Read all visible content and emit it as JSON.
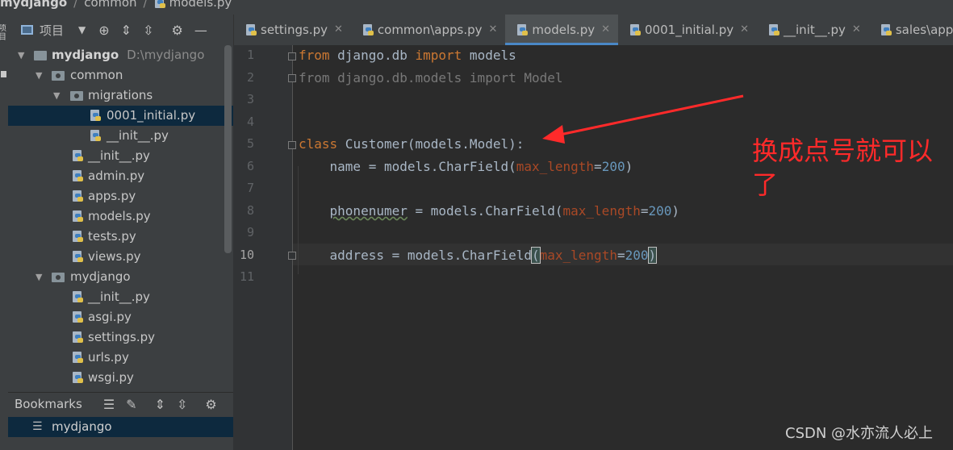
{
  "breadcrumb": {
    "project": "mydjango",
    "folder": "common",
    "file": "models.py"
  },
  "left_strip": {
    "vertical_label": "项目"
  },
  "project_panel": {
    "title": "项目",
    "toolbar_icons": [
      "chevron-down-icon",
      "crosshair-icon",
      "expand-icon",
      "collapse-icon",
      "gear-icon",
      "minimize-icon"
    ],
    "root": {
      "name": "mydjango",
      "path": "D:\\mydjango"
    },
    "items": [
      {
        "label": "common"
      },
      {
        "label": "migrations"
      },
      {
        "label": "0001_initial.py"
      },
      {
        "label": "__init__.py"
      },
      {
        "label": "__init__.py"
      },
      {
        "label": "admin.py"
      },
      {
        "label": "apps.py"
      },
      {
        "label": "models.py"
      },
      {
        "label": "tests.py"
      },
      {
        "label": "views.py"
      },
      {
        "label": "mydjango"
      },
      {
        "label": "__init__.py"
      },
      {
        "label": "asgi.py"
      },
      {
        "label": "settings.py"
      },
      {
        "label": "urls.py"
      },
      {
        "label": "wsgi.py"
      }
    ]
  },
  "bookmarks": {
    "title": "Bookmarks",
    "item": "mydjango"
  },
  "tabs": [
    {
      "label": "settings.py"
    },
    {
      "label": "common\\apps.py"
    },
    {
      "label": "models.py",
      "active": true
    },
    {
      "label": "0001_initial.py"
    },
    {
      "label": "__init__.py"
    },
    {
      "label": "sales\\apps.py"
    }
  ],
  "editor": {
    "line_numbers": [
      "1",
      "2",
      "3",
      "4",
      "5",
      "6",
      "7",
      "8",
      "9",
      "10",
      "11"
    ],
    "current_line": "10",
    "code": {
      "l1": {
        "kw1": "from",
        "mod": " django.db ",
        "kw2": "import",
        "rest": " models"
      },
      "l2": "from django.db.models import Model",
      "l5": {
        "kw": "class",
        "rest": " Customer(models.Model):"
      },
      "l6": {
        "pre": "    name = models.CharField(",
        "param": "max_length",
        "eq": "=",
        "num": "200",
        "post": ")"
      },
      "l8": {
        "pre1": "    ",
        "wavy": "phonenumer",
        "pre2": " = models.CharField(",
        "param": "max_length",
        "eq": "=",
        "num": "200",
        "post": ")"
      },
      "l10": {
        "pre": "    address = models.CharField",
        "open": "(",
        "param": "max_length",
        "eq": "=",
        "num": "200",
        "close": ")"
      }
    }
  },
  "annotation": {
    "text": "换成点号就可以了",
    "color": "#ff2a2a"
  },
  "watermark": "CSDN @水亦流人必上",
  "colors": {
    "keyword": "#cc7832",
    "param": "#aa4926",
    "number": "#6897bb",
    "selection": "#0d293e",
    "tab_underline": "#4a88c7"
  }
}
